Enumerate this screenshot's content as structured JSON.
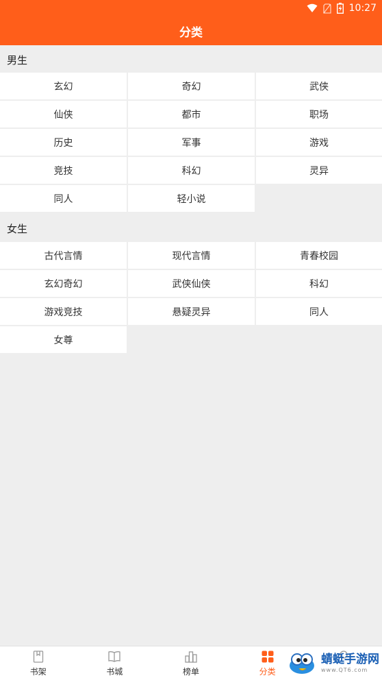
{
  "status": {
    "time": "10:27"
  },
  "header": {
    "title": "分类"
  },
  "male": {
    "title": "男生",
    "items": [
      "玄幻",
      "奇幻",
      "武侠",
      "仙侠",
      "都市",
      "职场",
      "历史",
      "军事",
      "游戏",
      "竞技",
      "科幻",
      "灵异",
      "同人",
      "轻小说"
    ]
  },
  "female": {
    "title": "女生",
    "items": [
      "古代言情",
      "现代言情",
      "青春校园",
      "玄幻奇幻",
      "武侠仙侠",
      "科幻",
      "游戏竞技",
      "悬疑灵异",
      "同人",
      "女尊"
    ]
  },
  "tabs": [
    {
      "label": "书架",
      "icon": "bookshelf-icon"
    },
    {
      "label": "书城",
      "icon": "book-open-icon"
    },
    {
      "label": "榜单",
      "icon": "ranking-icon"
    },
    {
      "label": "分类",
      "icon": "category-grid-icon",
      "active": true
    },
    {
      "label": "",
      "icon": "profile-icon"
    }
  ],
  "watermark": {
    "title": "蜻蜓手游网",
    "url": "www.QT6.com"
  },
  "colors": {
    "accent": "#ff5e1a",
    "background": "#eeeeee"
  }
}
